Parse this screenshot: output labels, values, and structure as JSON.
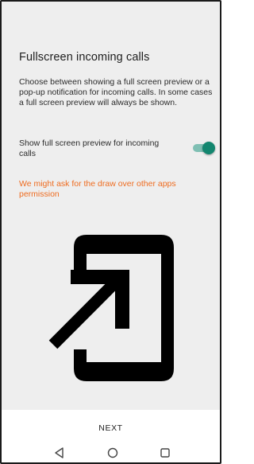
{
  "screen": {
    "title": "Fullscreen incoming calls",
    "description": "Choose between showing a full screen preview or a pop-up notification for incoming calls. In some cases a full screen preview will always be shown.",
    "toggle": {
      "label": "Show full screen preview for incoming calls",
      "checked": true
    },
    "warning": "We might ask for the draw over other apps permission",
    "illustration_icon": "phone-enter-arrow-icon"
  },
  "footer": {
    "next_label": "NEXT"
  },
  "navigation_bar": {
    "back_icon": "triangle-back-icon",
    "home_icon": "circle-home-icon",
    "recents_icon": "square-recents-icon"
  },
  "colors": {
    "background": "#eeeeee",
    "accent": "#13866f",
    "accent_track": "#7fbfb3",
    "warning": "#ee6c20",
    "text": "#1f1f1f"
  }
}
